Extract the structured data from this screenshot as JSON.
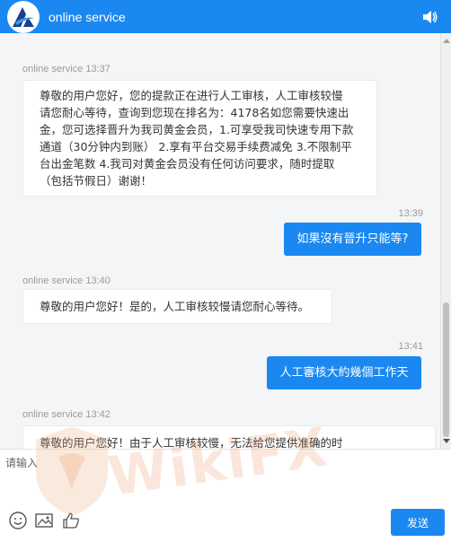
{
  "header": {
    "title": "online service"
  },
  "messages": [
    {
      "sender": "online service",
      "time": "13:37",
      "lines": [
        "尊敬的用户您好，您的提款正在进行人工审核，人工审核较慢",
        "请您耐心等待，查询到您现在排名为：4178名如您需要快速出",
        "金，您可选择晋升为我司黄金会员，1.可享受我司快速专用下款",
        "通道（30分钟内到账） 2.享有平台交易手续费减免 3.不限制平",
        "台出金笔数 4.我司对黄金会员没有任何访问要求，随时提取",
        "（包括节假日）谢谢！"
      ]
    },
    {
      "time": "13:39",
      "text": "如果沒有晉升只能等?"
    },
    {
      "sender": "online service",
      "time": "13:40",
      "text": "尊敬的用户您好！是的，人工审核较慢请您耐心等待。"
    },
    {
      "time": "13:41",
      "text": "人工審核大約幾個工作天"
    },
    {
      "sender": "online service",
      "time": "13:42",
      "text": "尊敬的用户您好！由于人工审核较慢，无法给您提供准确的时"
    }
  ],
  "input": {
    "placeholder": "请输入"
  },
  "send_label": "发送",
  "watermark": "WikiFX",
  "colors": {
    "accent": "#1a88f0",
    "chat_bg": "#f4f5f7"
  },
  "icons": [
    "speaker-icon",
    "emoji-icon",
    "image-icon",
    "thumbs-up-icon"
  ]
}
